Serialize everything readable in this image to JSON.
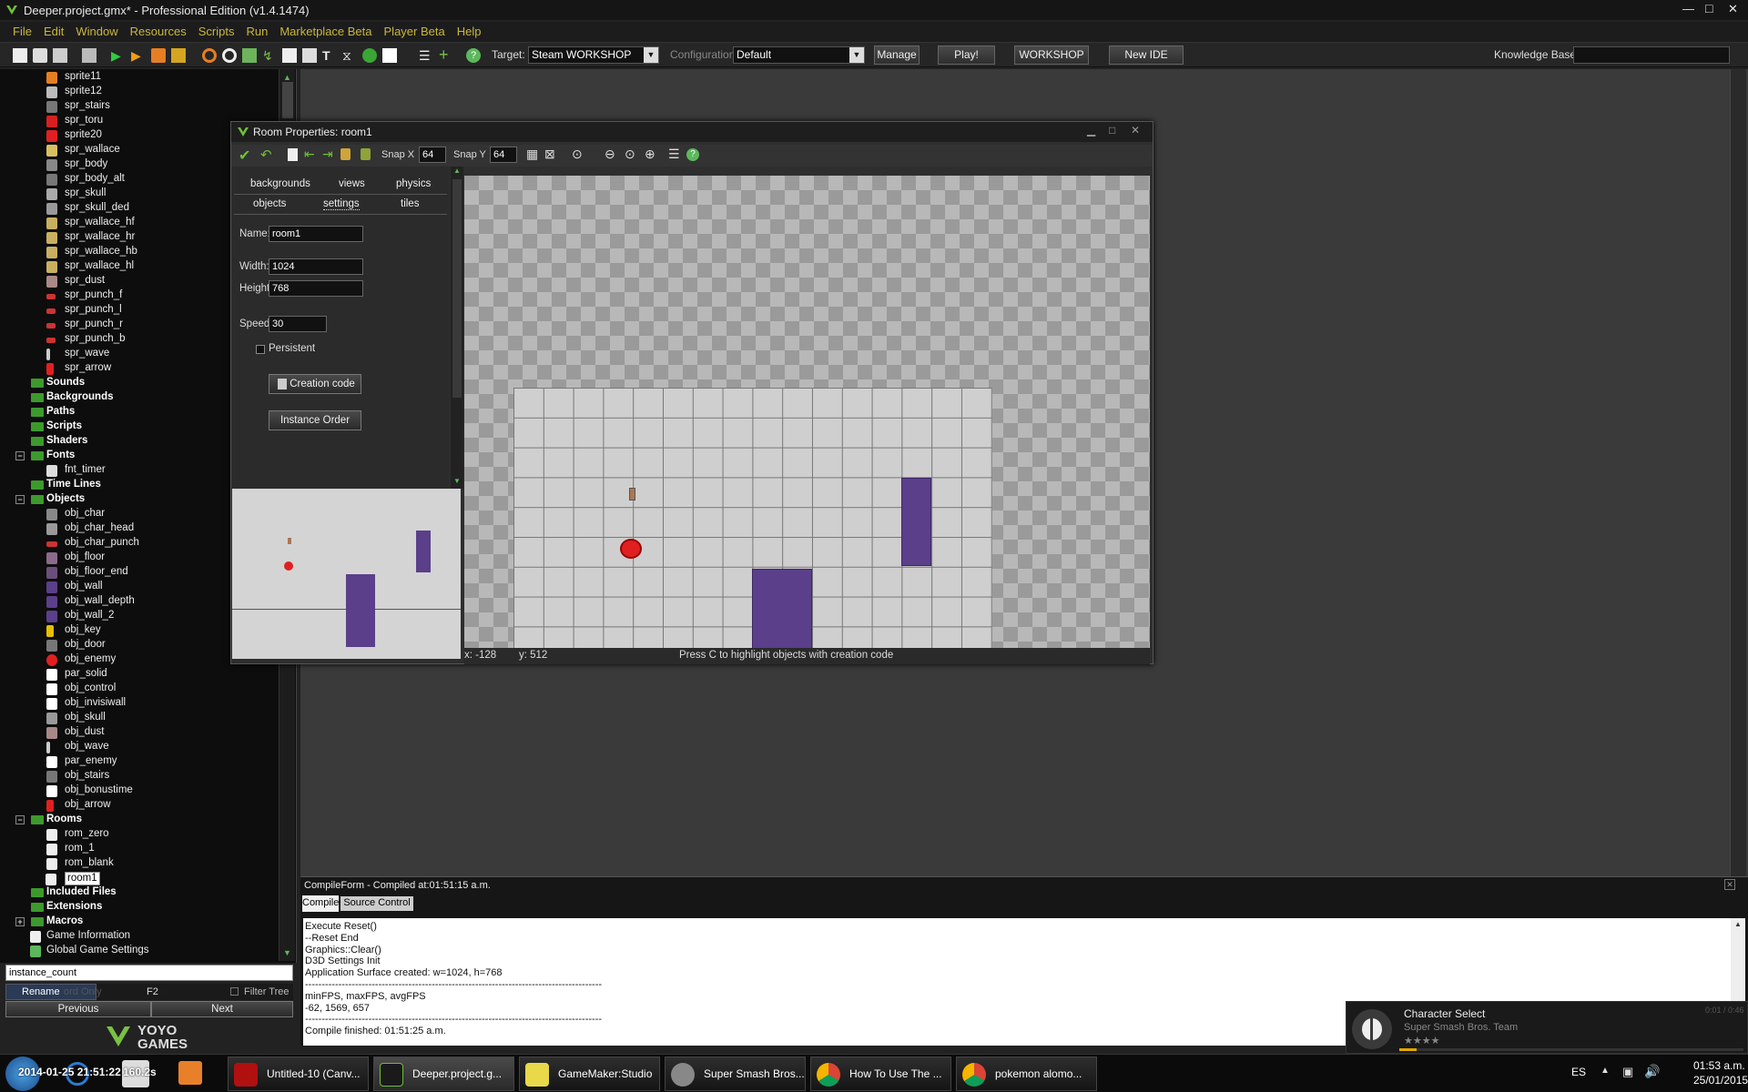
{
  "window": {
    "title": "Deeper.project.gmx* - Professional Edition (v1.4.1474)",
    "ctrl_min": "—",
    "ctrl_max": "□",
    "ctrl_close": "✕"
  },
  "menu": [
    "File",
    "Edit",
    "Window",
    "Resources",
    "Scripts",
    "Run",
    "Marketplace Beta",
    "Player Beta",
    "Help"
  ],
  "toolbar": {
    "target_label": "Target:",
    "target_value": "Steam WORKSHOP",
    "config_label": "Configuration:",
    "config_value": "Default",
    "manage": "Manage",
    "play": "Play!",
    "workshop": "WORKSHOP",
    "new_ide": "New IDE",
    "kb_label": "Knowledge Base:",
    "kb_value": ""
  },
  "tree": {
    "sprites": [
      "sprite11",
      "sprite12",
      "spr_stairs",
      "spr_toru",
      "sprite20",
      "spr_wallace",
      "spr_body",
      "spr_body_alt",
      "spr_skull",
      "spr_skull_ded",
      "spr_wallace_hf",
      "spr_wallace_hr",
      "spr_wallace_hb",
      "spr_wallace_hl",
      "spr_dust",
      "spr_punch_f",
      "spr_punch_l",
      "spr_punch_r",
      "spr_punch_b",
      "spr_wave",
      "spr_arrow"
    ],
    "groups1": [
      "Sounds",
      "Backgrounds",
      "Paths",
      "Scripts",
      "Shaders"
    ],
    "fonts": "Fonts",
    "font_items": [
      "fnt_timer"
    ],
    "timelines": "Time Lines",
    "objects": "Objects",
    "object_items": [
      "obj_char",
      "obj_char_head",
      "obj_char_punch",
      "obj_floor",
      "obj_floor_end",
      "obj_wall",
      "obj_wall_depth",
      "obj_wall_2",
      "obj_key",
      "obj_door",
      "obj_enemy",
      "par_solid",
      "obj_control",
      "obj_invisiwall",
      "obj_skull",
      "obj_dust",
      "obj_wave",
      "par_enemy",
      "obj_stairs",
      "obj_bonustime",
      "obj_arrow"
    ],
    "rooms": "Rooms",
    "room_items": [
      "rom_zero",
      "rom_1",
      "rom_blank",
      "room1"
    ],
    "groups2": [
      "Included Files",
      "Extensions",
      "Macros"
    ],
    "game_info": "Game Information",
    "global_settings": "Global Game Settings"
  },
  "search": {
    "value": "instance_count",
    "rename": "Rename",
    "hidden_text": "ord Only",
    "shortcut": "F2",
    "filter": "Filter Tree",
    "prev": "Previous",
    "next": "Next"
  },
  "logo": {
    "top": "YOYO",
    "bottom": "GAMES"
  },
  "room": {
    "title": "Room Properties: room1",
    "snapx_label": "Snap X",
    "snapx": "64",
    "snapy_label": "Snap Y",
    "snapy": "64",
    "tabs_row1": [
      "backgrounds",
      "views",
      "physics"
    ],
    "tabs_row2": [
      "objects",
      "settings",
      "tiles"
    ],
    "name_label": "Name:",
    "name": "room1",
    "width_label": "Width:",
    "width": "1024",
    "height_label": "Height:",
    "height": "768",
    "speed_label": "Speed:",
    "speed": "30",
    "persistent": "Persistent",
    "creation_code": "Creation code",
    "instance_order": "Instance Order",
    "status_x": "x: -128",
    "status_y": "y: 512",
    "status_hint": "Press C to highlight objects with creation code"
  },
  "compile": {
    "title": "CompileForm - Compiled at:01:51:15 a.m.",
    "tabs": [
      "Compile",
      "Source Control"
    ],
    "output": "Execute Reset()\n--Reset End\nGraphics::Clear()\nD3D Settings Init\nApplication Surface created: w=1024, h=768\n-----------------------------------------------------------------------------------------\nminFPS, maxFPS, avgFPS\n-62, 1569, 657\n-----------------------------------------------------------------------------------------\nCompile finished: 01:51:25 a.m."
  },
  "notification": {
    "title": "Character Select",
    "subtitle": "Super Smash Bros. Team",
    "time": "0:01 / 0:46",
    "stars": "★★★★"
  },
  "taskbar": {
    "items": [
      "Untitled-10 (Canv...",
      "Deeper.project.g...",
      "GameMaker:Studio",
      "Super Smash Bros...",
      "How To Use The ...",
      "pokemon alomo..."
    ],
    "overlay_text": "2014-01-25 21:51:22",
    "qs_text": "160.2s",
    "lang": "ES",
    "time": "01:53 a.m.",
    "date": "25/01/2015"
  }
}
